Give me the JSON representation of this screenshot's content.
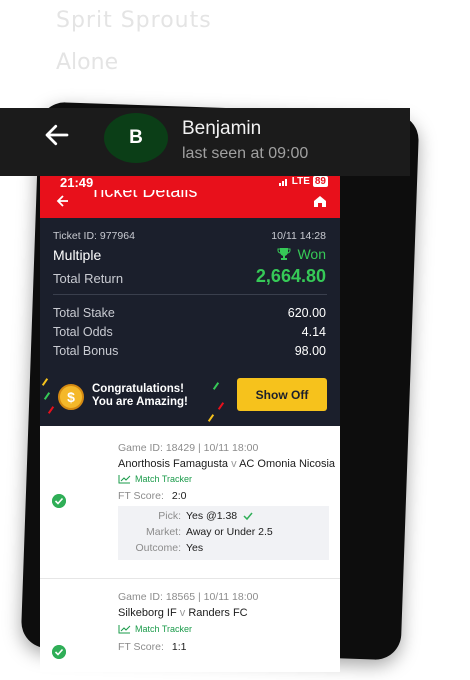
{
  "background_text": {
    "line1": "Sprit Sprouts",
    "line2": "Alone"
  },
  "chat_header": {
    "contact_name": "Benjamin",
    "last_seen": "last seen at 09:00",
    "avatar_letter": "B",
    "back_icon": "arrow-left-icon"
  },
  "phone": {
    "status_time": "21:49",
    "network": "LTE",
    "battery": "89",
    "app_title": "Ticket Details",
    "home_icon": "home-icon"
  },
  "ticket": {
    "ticket_id": "Ticket ID: 977964",
    "date": "10/11 14:28",
    "bet_type": "Multiple",
    "status": "Won",
    "status_icon": "trophy-icon",
    "total_return_label": "Total Return",
    "total_return_value": "2,664.80",
    "rows": [
      {
        "label": "Total Stake",
        "value": "620.00"
      },
      {
        "label": "Total Odds",
        "value": "4.14"
      },
      {
        "label": "Total Bonus",
        "value": "98.00"
      }
    ]
  },
  "promo": {
    "coin_symbol": "$",
    "line1": "Congratulations!",
    "line2": "You are Amazing!",
    "button_label": "Show Off"
  },
  "games": [
    {
      "meta": "Game ID: 18429 | 10/11 18:00",
      "home": "Anorthosis Famagusta",
      "vs": "v",
      "away": "AC Omonia Nicosia",
      "tracker_label": "Match Tracker",
      "ft_label": "FT Score:",
      "ft_score": "2:0",
      "pick_label": "Pick:",
      "pick_value": "Yes @1.38",
      "market_label": "Market:",
      "market_value": "Away or Under 2.5",
      "outcome_label": "Outcome:",
      "outcome_value": "Yes"
    },
    {
      "meta": "Game ID: 18565 | 10/11 18:00",
      "home": "Silkeborg IF",
      "vs": "v",
      "away": "Randers FC",
      "tracker_label": "Match Tracker",
      "ft_label": "FT Score:",
      "ft_score": "1:1"
    }
  ],
  "colors": {
    "brand_red": "#e8101b",
    "ticket_bg": "#1b1f2c",
    "won_green": "#36c957",
    "button_yellow": "#f6c21c"
  }
}
